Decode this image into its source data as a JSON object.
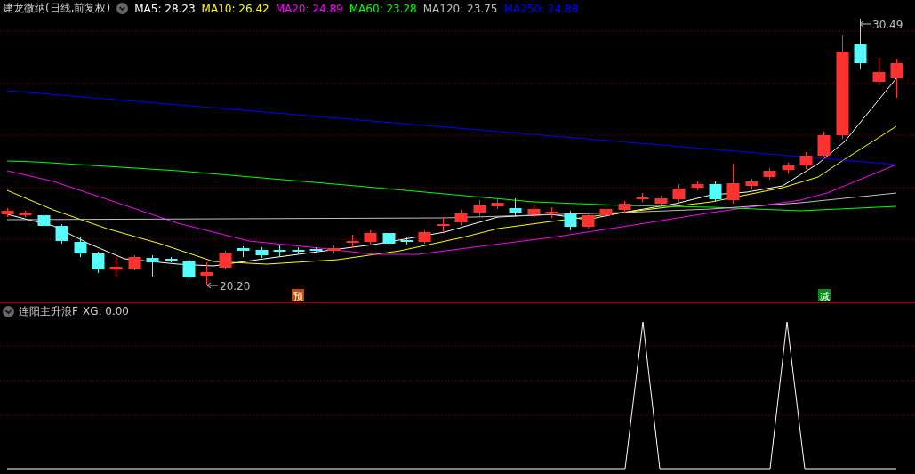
{
  "chart_header": {
    "title": "建龙微纳(日线,前复权)",
    "averages": [
      {
        "label": "MA5: 28.23",
        "color": "#ffffff"
      },
      {
        "label": "MA10: 26.42",
        "color": "#ffff00"
      },
      {
        "label": "MA20: 24.89",
        "color": "#ff00ff"
      },
      {
        "label": "MA60: 23.28",
        "color": "#00ff00"
      },
      {
        "label": "MA120: 23.75",
        "color": "#c0c0c0"
      },
      {
        "label": "MA250: 24.88",
        "color": "#0000ff"
      }
    ]
  },
  "price_labels": [
    {
      "text": "30.49",
      "kind": "high"
    },
    {
      "text": "20.20",
      "kind": "low"
    }
  ],
  "signal_badges": [
    {
      "text": "预",
      "kind": "forecast"
    },
    {
      "text": "减",
      "kind": "reduce"
    }
  ],
  "indicator_header": {
    "title": "连阳主升浪F",
    "reading": "XG: 0.00"
  }
}
